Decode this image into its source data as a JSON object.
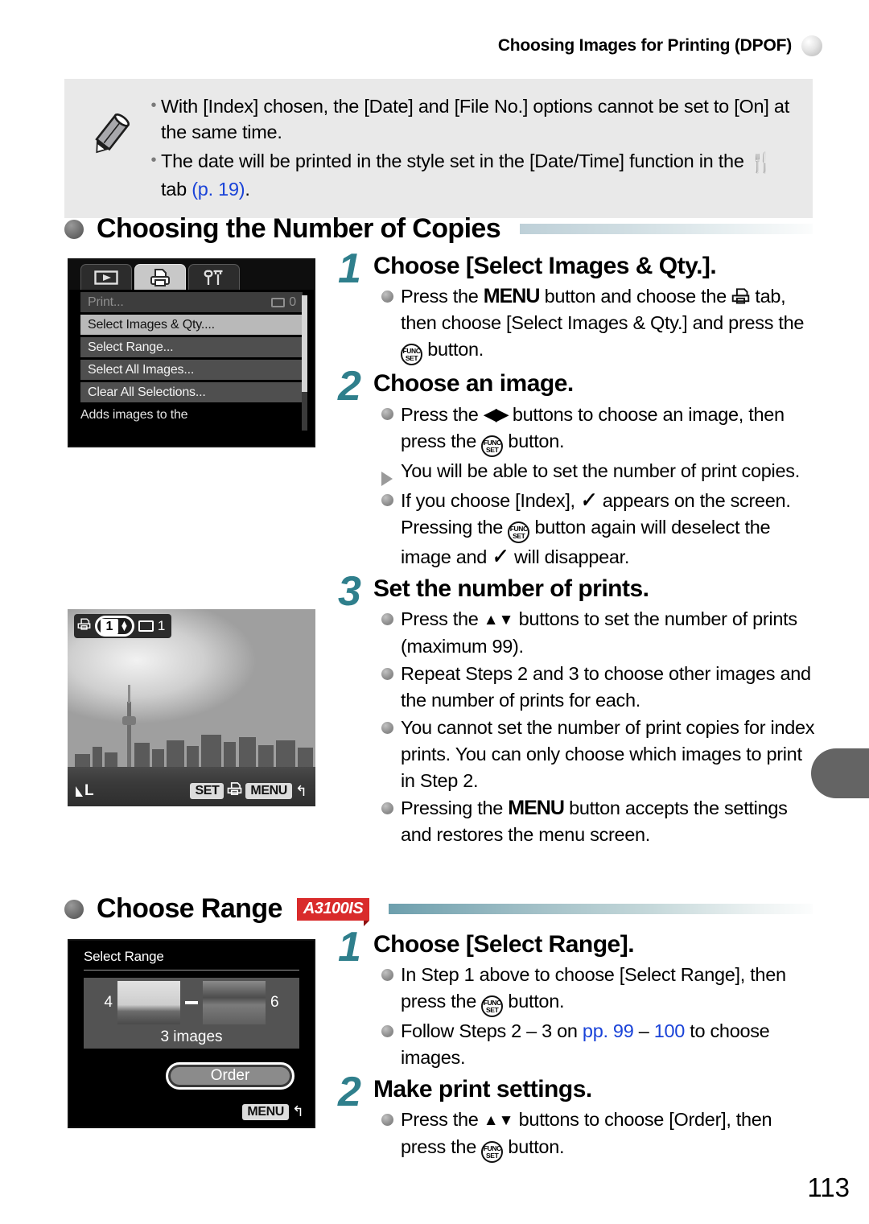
{
  "header": {
    "title": "Choosing Images for Printing (DPOF)",
    "dot_icon": "sphere-icon"
  },
  "note_box": {
    "icon": "pencil-icon",
    "items": [
      "With [Index] chosen, the [Date] and [File No.] options cannot be set to [On] at the same time.",
      "The date will be printed in the style set in the [Date/Time] function in the"
    ],
    "item2_tail_tab": "tab",
    "item2_pageref": "(p. 19)",
    "item2_tail_end": "."
  },
  "section1": {
    "title": "Choosing the Number of Copies",
    "lcd": {
      "tabs": [
        {
          "name": "playback-tab",
          "glyph": "▶",
          "active": false
        },
        {
          "name": "print-tab",
          "glyph": "print",
          "active": true
        },
        {
          "name": "settings-tab",
          "glyph": "tools",
          "active": false
        }
      ],
      "rows": [
        {
          "label": "Print...",
          "value": "0",
          "state": "dim",
          "has_card_icon": true
        },
        {
          "label": "Select Images & Qty....",
          "value": "",
          "state": "selected",
          "has_card_icon": false
        },
        {
          "label": "Select Range...",
          "value": "",
          "state": "normal",
          "has_card_icon": false
        },
        {
          "label": "Select All Images...",
          "value": "",
          "state": "normal",
          "has_card_icon": false
        },
        {
          "label": "Clear All Selections...",
          "value": "",
          "state": "normal",
          "has_card_icon": false
        }
      ],
      "hint": "Adds images to the"
    },
    "photo_lcd": {
      "copies": "1",
      "total": "1",
      "quality": "L",
      "set_key": "SET",
      "menu_key": "MENU",
      "print_icon": "print-icon",
      "back_icon": "return-arrow-icon"
    },
    "steps": [
      {
        "num": "1",
        "title": "Choose [Select Images & Qty.].",
        "bullets": [
          {
            "mark": "dot",
            "parts": [
              {
                "t": "text",
                "v": "Press the "
              },
              {
                "t": "menu",
                "v": "MENU"
              },
              {
                "t": "text",
                "v": " button and choose the "
              },
              {
                "t": "print",
                "v": "⎙"
              },
              {
                "t": "text",
                "v": " tab, then choose [Select Images & Qty.] and press the "
              },
              {
                "t": "func",
                "v": "FUNC SET"
              },
              {
                "t": "text",
                "v": " button."
              }
            ]
          }
        ]
      },
      {
        "num": "2",
        "title": "Choose an image.",
        "bullets": [
          {
            "mark": "dot",
            "parts": [
              {
                "t": "text",
                "v": "Press the "
              },
              {
                "t": "lr",
                "v": "◀▶"
              },
              {
                "t": "text",
                "v": " buttons to choose an image, then press the "
              },
              {
                "t": "func",
                "v": "FUNC SET"
              },
              {
                "t": "text",
                "v": " button."
              }
            ]
          },
          {
            "mark": "triangle",
            "parts": [
              {
                "t": "text",
                "v": "You will be able to set the number of print copies."
              }
            ]
          },
          {
            "mark": "dot",
            "parts": [
              {
                "t": "text",
                "v": "If you choose [Index], "
              },
              {
                "t": "check",
                "v": "✓"
              },
              {
                "t": "text",
                "v": " appears on the screen. Pressing the "
              },
              {
                "t": "func",
                "v": "FUNC SET"
              },
              {
                "t": "text",
                "v": " button again will deselect the image and "
              },
              {
                "t": "check",
                "v": "✓"
              },
              {
                "t": "text",
                "v": " will disappear."
              }
            ]
          }
        ]
      },
      {
        "num": "3",
        "title": "Set the number of prints.",
        "bullets": [
          {
            "mark": "dot",
            "parts": [
              {
                "t": "text",
                "v": "Press the "
              },
              {
                "t": "ud",
                "v": "▲▼"
              },
              {
                "t": "text",
                "v": " buttons to set the number of prints (maximum 99)."
              }
            ]
          },
          {
            "mark": "dot",
            "parts": [
              {
                "t": "text",
                "v": "Repeat Steps 2 and 3 to choose other images and the number of prints for each."
              }
            ]
          },
          {
            "mark": "dot",
            "parts": [
              {
                "t": "text",
                "v": "You cannot set the number of print copies for index prints. You can only choose which images to print in Step 2."
              }
            ]
          },
          {
            "mark": "dot",
            "parts": [
              {
                "t": "text",
                "v": "Pressing the "
              },
              {
                "t": "menu",
                "v": "MENU"
              },
              {
                "t": "text",
                "v": " button accepts the settings and restores the menu screen."
              }
            ]
          }
        ]
      }
    ]
  },
  "section2": {
    "title": "Choose Range",
    "model_badge": "A3100IS",
    "lcd": {
      "title": "Select Range",
      "start_index": "4",
      "end_index": "6",
      "count_label": "3 images",
      "order_button": "Order",
      "menu_key": "MENU",
      "back_icon": "return-arrow-icon"
    },
    "steps": [
      {
        "num": "1",
        "title": "Choose [Select Range].",
        "bullets": [
          {
            "mark": "dot",
            "parts": [
              {
                "t": "text",
                "v": "In Step 1 above to choose [Select Range], then press the "
              },
              {
                "t": "func",
                "v": "FUNC SET"
              },
              {
                "t": "text",
                "v": " button."
              }
            ]
          },
          {
            "mark": "dot",
            "parts": [
              {
                "t": "text",
                "v": "Follow Steps 2 – 3 on "
              },
              {
                "t": "link",
                "v": "pp. 99"
              },
              {
                "t": "text",
                "v": " – "
              },
              {
                "t": "link",
                "v": "100"
              },
              {
                "t": "text",
                "v": " to choose images."
              }
            ]
          }
        ]
      },
      {
        "num": "2",
        "title": "Make print settings.",
        "bullets": [
          {
            "mark": "dot",
            "parts": [
              {
                "t": "text",
                "v": "Press the "
              },
              {
                "t": "ud",
                "v": "▲▼"
              },
              {
                "t": "text",
                "v": " buttons to choose [Order], then press the "
              },
              {
                "t": "func",
                "v": "FUNC SET"
              },
              {
                "t": "text",
                "v": " button."
              }
            ]
          }
        ]
      }
    ]
  },
  "folio": "113",
  "colors": {
    "step_number": "#2f7f8c",
    "page_link": "#1a43d8",
    "model_badge_bg": "#d92b2b",
    "note_bg": "#e9e9e9"
  }
}
